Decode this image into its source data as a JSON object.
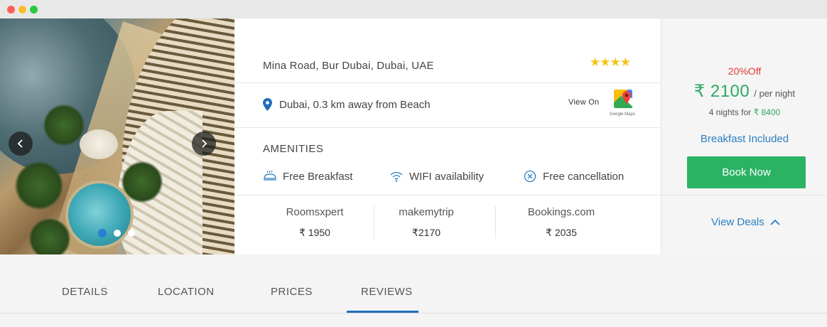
{
  "hotel": {
    "address": "Mina Road, Bur Dubai, Dubai, UAE",
    "rating": 4,
    "stars_text": "★★★★",
    "location_text": "Dubai, 0.3 km away from Beach",
    "view_on_label": "View On",
    "maps_label": "Google Maps"
  },
  "carousel": {
    "slide_count": 3,
    "active_slide": 1
  },
  "amenities": {
    "title": "AMENITIES",
    "items": [
      {
        "label": "Free Breakfast",
        "icon": "breakfast-icon"
      },
      {
        "label": "WIFI availability",
        "icon": "wifi-icon"
      },
      {
        "label": "Free cancellation",
        "icon": "cancel-circle-icon"
      }
    ]
  },
  "partners": [
    {
      "name": "Roomsxpert",
      "price": "₹ 1950"
    },
    {
      "name": "makemytrip",
      "price": "₹2170"
    },
    {
      "name": "Bookings.com",
      "price": "₹ 2035"
    }
  ],
  "pricing": {
    "discount": "20%Off",
    "price": "₹ 2100",
    "per_night": "/ per night",
    "nights_label": "4 nights for",
    "nights_total": "₹ 8400",
    "breakfast": "Breakfast Included",
    "book_label": "Book Now",
    "view_deals_label": "View Deals"
  },
  "tabs": [
    {
      "label": "DETAILS"
    },
    {
      "label": "LOCATION"
    },
    {
      "label": "PRICES"
    },
    {
      "label": "REVIEWS",
      "active": true
    }
  ],
  "colors": {
    "accent_blue": "#2a7fc1",
    "price_green": "#2ea865",
    "discount_red": "#e53935",
    "star_yellow": "#f5c518",
    "button_green": "#2bb364"
  }
}
